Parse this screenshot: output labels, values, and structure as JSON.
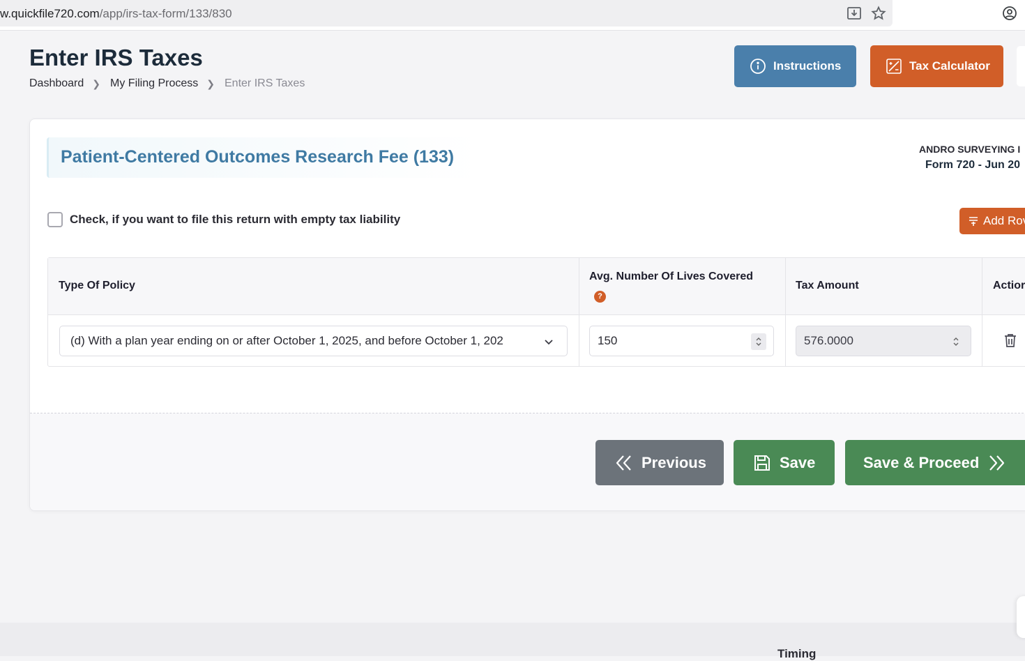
{
  "browser": {
    "url_host": "w.quickfile720.com",
    "url_path": "/app/irs-tax-form/133/830"
  },
  "header": {
    "title": "Enter IRS Taxes",
    "breadcrumb": [
      "Dashboard",
      "My Filing Process",
      "Enter IRS Taxes"
    ],
    "instructions_label": "Instructions",
    "calculator_label": "Tax Calculator"
  },
  "section": {
    "title": "Patient-Centered Outcomes Research Fee (133)",
    "company": "ANDRO SURVEYING I",
    "form_period": "Form 720 - Jun 20"
  },
  "empty_liability": {
    "label": "Check, if you want to file this return with empty tax liability",
    "checked": false
  },
  "add_row_label": "Add Rov",
  "table": {
    "headers": {
      "policy": "Type Of Policy",
      "lives": "Avg. Number Of Lives Covered",
      "amount": "Tax Amount",
      "action": "Actior"
    },
    "help_glyph": "?",
    "rows": [
      {
        "policy": "(d) With a plan year ending on or after October 1, 2025, and before October 1, 202",
        "lives": "150",
        "amount": "576.0000"
      }
    ]
  },
  "footer": {
    "previous_label": "Previous",
    "save_label": "Save",
    "proceed_label": "Save & Proceed",
    "timing_label": "Timing"
  },
  "colors": {
    "primary_blue": "#4a7fab",
    "accent_orange": "#d15e28",
    "success_green": "#4a8a55",
    "secondary_gray": "#6c737a",
    "title_blue": "#3f7aa3"
  },
  "icons": [
    "download-icon",
    "star-icon",
    "profile-icon",
    "info-icon",
    "calculator-icon",
    "add-row-icon",
    "help-icon",
    "chevron-down-icon",
    "spinner-icon",
    "trash-icon",
    "double-chevron-left-icon",
    "floppy-disk-icon",
    "double-chevron-right-icon"
  ]
}
